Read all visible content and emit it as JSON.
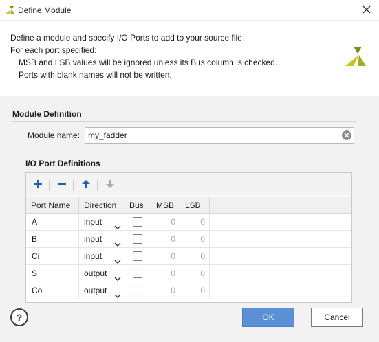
{
  "window": {
    "title": "Define Module",
    "icons": {
      "app": "xilinx-logo-icon",
      "close": "close-icon"
    }
  },
  "intro": {
    "line1": "Define a module and specify I/O Ports to add to your source file.",
    "line2": "For each port specified:",
    "line3": "MSB and LSB values will be ignored unless its Bus column is checked.",
    "line4": "Ports with blank names will not be written."
  },
  "module_definition": {
    "section_title": "Module Definition",
    "label_accel": "M",
    "label_rest": "odule name:",
    "value": "my_fadder"
  },
  "io_ports": {
    "section_title": "I/O Port Definitions",
    "toolbar": {
      "add_icon": "plus-icon",
      "remove_icon": "minus-icon",
      "up_icon": "arrow-up-icon",
      "down_icon": "arrow-down-icon"
    },
    "columns": [
      "Port Name",
      "Direction",
      "Bus",
      "MSB",
      "LSB"
    ],
    "rows": [
      {
        "name": "A",
        "direction": "input",
        "bus": false,
        "msb": "0",
        "lsb": "0"
      },
      {
        "name": "B",
        "direction": "input",
        "bus": false,
        "msb": "0",
        "lsb": "0"
      },
      {
        "name": "Ci",
        "direction": "input",
        "bus": false,
        "msb": "0",
        "lsb": "0"
      },
      {
        "name": "S",
        "direction": "output",
        "bus": false,
        "msb": "0",
        "lsb": "0"
      },
      {
        "name": "Co",
        "direction": "output",
        "bus": false,
        "msb": "0",
        "lsb": "0"
      }
    ]
  },
  "footer": {
    "help_label": "?",
    "ok_label": "OK",
    "cancel_label": "Cancel"
  },
  "colors": {
    "accent": "#5b8fd6",
    "toolbar_icon": "#1f5ea8",
    "logo_yellow": "#c9c423",
    "logo_olive": "#7f8c1c"
  }
}
